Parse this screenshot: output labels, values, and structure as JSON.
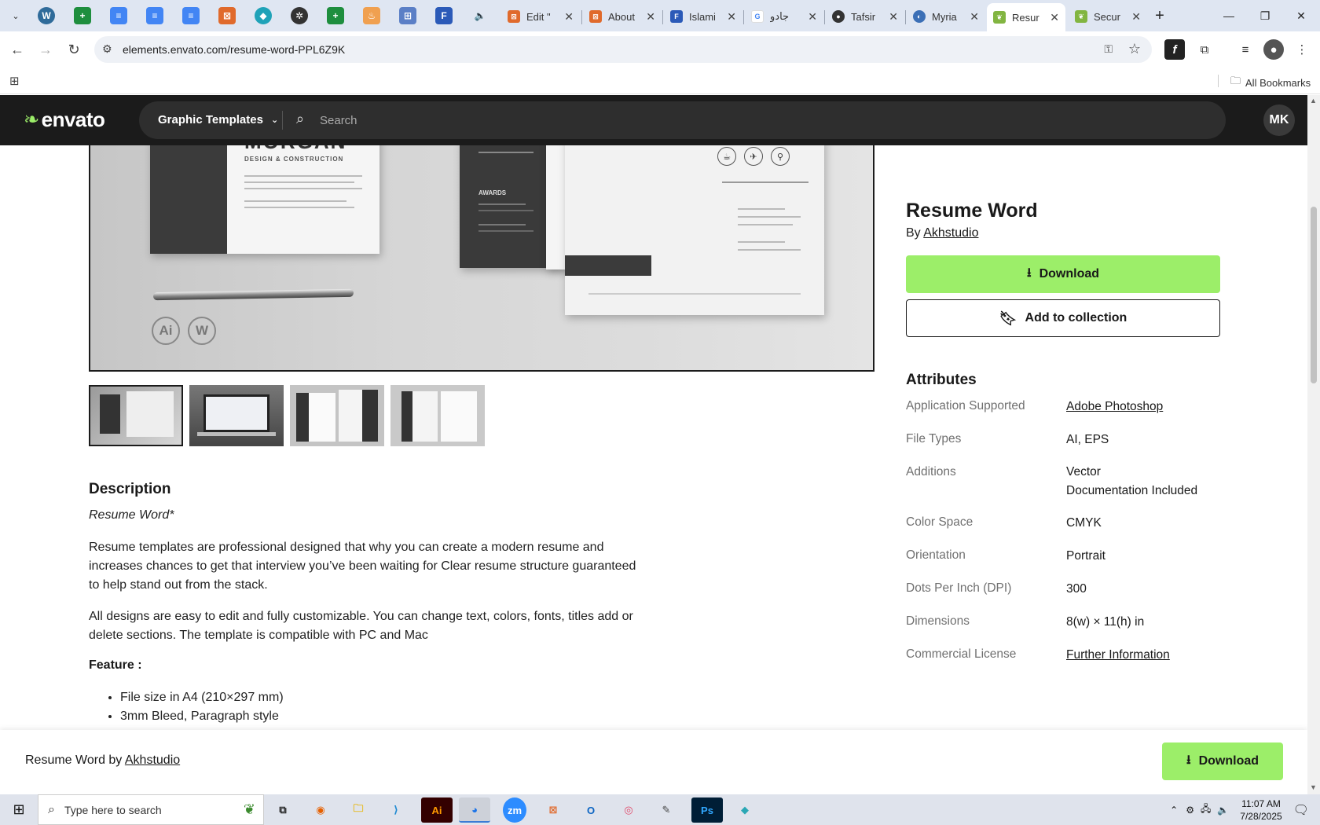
{
  "browser": {
    "tabs": [
      {
        "title": "Edit \"",
        "color": "#e06a2c"
      },
      {
        "title": "About",
        "color": "#e06a2c"
      },
      {
        "title": "Islami",
        "color": "#2b5ab8"
      },
      {
        "title": "جادو",
        "color": "#4285f4"
      },
      {
        "title": "Tafsir",
        "color": "#333333"
      },
      {
        "title": "Myria",
        "color": "#3b6fb6"
      },
      {
        "title": "Resur",
        "color": "#82b541",
        "active": true
      },
      {
        "title": "Secur",
        "color": "#82b541"
      }
    ],
    "new_tab_symbol": "+",
    "url": "elements.envato.com/resume-word-PPL6Z9K",
    "all_bookmarks": "All Bookmarks"
  },
  "header": {
    "logo_text": "envato",
    "category": "Graphic Templates",
    "search_placeholder": "Search",
    "avatar_initials": "MK"
  },
  "preview": {
    "brand_text": "MORGAN",
    "brand_sub": "DESIGN & CONSTRUCTION",
    "section_awards": "AWARDS",
    "badge_ai": "Ai",
    "badge_w": "W",
    "thumbnail_count": 4
  },
  "item": {
    "title": "Resume Word",
    "by_label": "By",
    "author": "Akhstudio",
    "download_label": "Download",
    "add_collection_label": "Add to collection"
  },
  "attributes": {
    "heading": "Attributes",
    "rows": [
      {
        "key": "Application Supported",
        "value": "Adobe Photoshop",
        "link": true
      },
      {
        "key": "File Types",
        "value": "AI, EPS",
        "link": false
      },
      {
        "key": "Additions",
        "value": "Vector",
        "value2": "Documentation Included",
        "link": false
      },
      {
        "key": "Color Space",
        "value": "CMYK",
        "link": false
      },
      {
        "key": "Orientation",
        "value": "Portrait",
        "link": false
      },
      {
        "key": "Dots Per Inch (DPI)",
        "value": "300",
        "link": false
      },
      {
        "key": "Dimensions",
        "value": "8(w) × 11(h) in",
        "link": false
      },
      {
        "key": "Commercial License",
        "value": "Further Information",
        "link": true
      }
    ]
  },
  "description": {
    "heading": "Description",
    "subtitle": "Resume Word*",
    "paragraph1": "Resume templates are professional designed that why you can create a modern resume and increases chances to get that interview you’ve been waiting for Clear resume structure guaranteed to help stand out from the stack.",
    "paragraph2": "All designs are easy to edit and fully customizable. You can change text, colors, fonts, titles add or delete sections. The template is compatible with PC and Mac",
    "feature_heading": "Feature :",
    "features": [
      "File size in A4 (210×297 mm)",
      "3mm Bleed, Paragraph style"
    ]
  },
  "sticky": {
    "label_prefix": "Resume Word by",
    "author": "Akhstudio",
    "download_label": "Download"
  },
  "taskbar": {
    "search_placeholder": "Type here to search",
    "time": "11:07 AM",
    "date": "7/28/2025"
  },
  "colors": {
    "accent_green": "#9cee69",
    "header_dark": "#1b1b1b"
  }
}
